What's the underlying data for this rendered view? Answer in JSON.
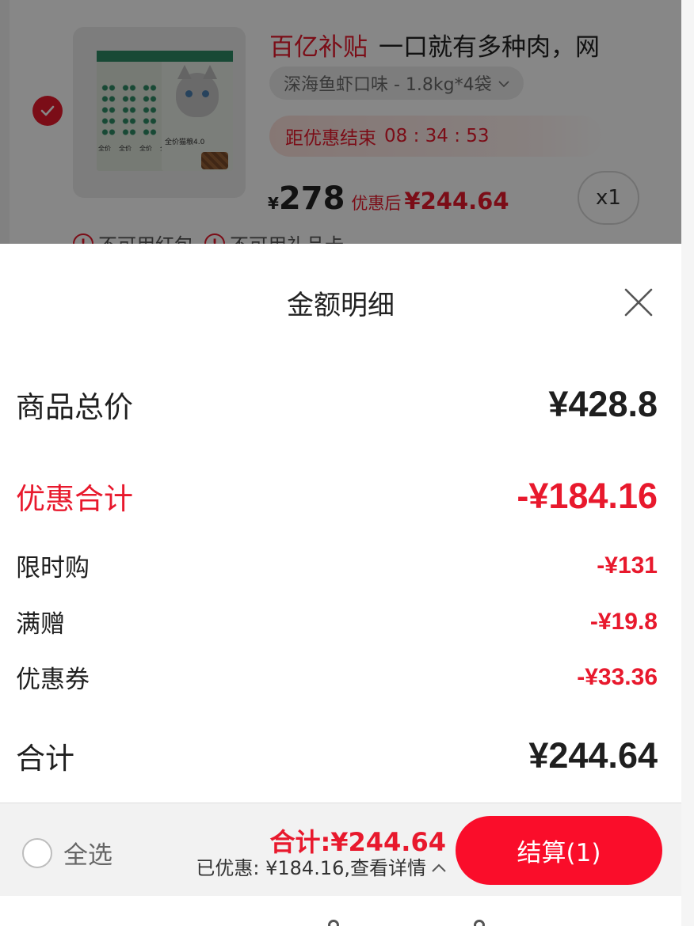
{
  "cart_item": {
    "subsidy_tag": "百亿补贴",
    "title": "一口就有多种肉，网",
    "variant": "深海鱼虾口味 - 1.8kg*4袋",
    "countdown_label": "距优惠结束",
    "countdown_time": "08 : 34 : 53",
    "price_symbol": "¥",
    "price": "278",
    "after_label": "优惠后",
    "after_price": "¥244.64",
    "quantity": "x1",
    "limits": [
      "不可用红包",
      "不可用礼品卡"
    ],
    "package_text": "全价猫粮4.0",
    "selected": true
  },
  "sheet": {
    "title": "金额明细",
    "total_label": "商品总价",
    "total_value": "¥428.8",
    "discount_label": "优惠合计",
    "discount_value": "-¥184.16",
    "discount_items": [
      {
        "label": "限时购",
        "value": "-¥131"
      },
      {
        "label": "满赠",
        "value": "-¥19.8"
      },
      {
        "label": "优惠券",
        "value": "-¥33.36"
      }
    ],
    "final_label": "合计",
    "final_value": "¥244.64"
  },
  "bottom_bar": {
    "select_all_label": "全选",
    "sum_text": "合计:¥244.64",
    "saved_text": "已优惠: ¥184.16,查看详情",
    "checkout_label": "结算(1)"
  },
  "colors": {
    "accent_red": "#e8192d",
    "checkout_red": "#fa0d2a"
  },
  "icons": [
    "check-icon",
    "chevron-down-icon",
    "warning-icon",
    "close-icon",
    "chevron-up-icon"
  ]
}
